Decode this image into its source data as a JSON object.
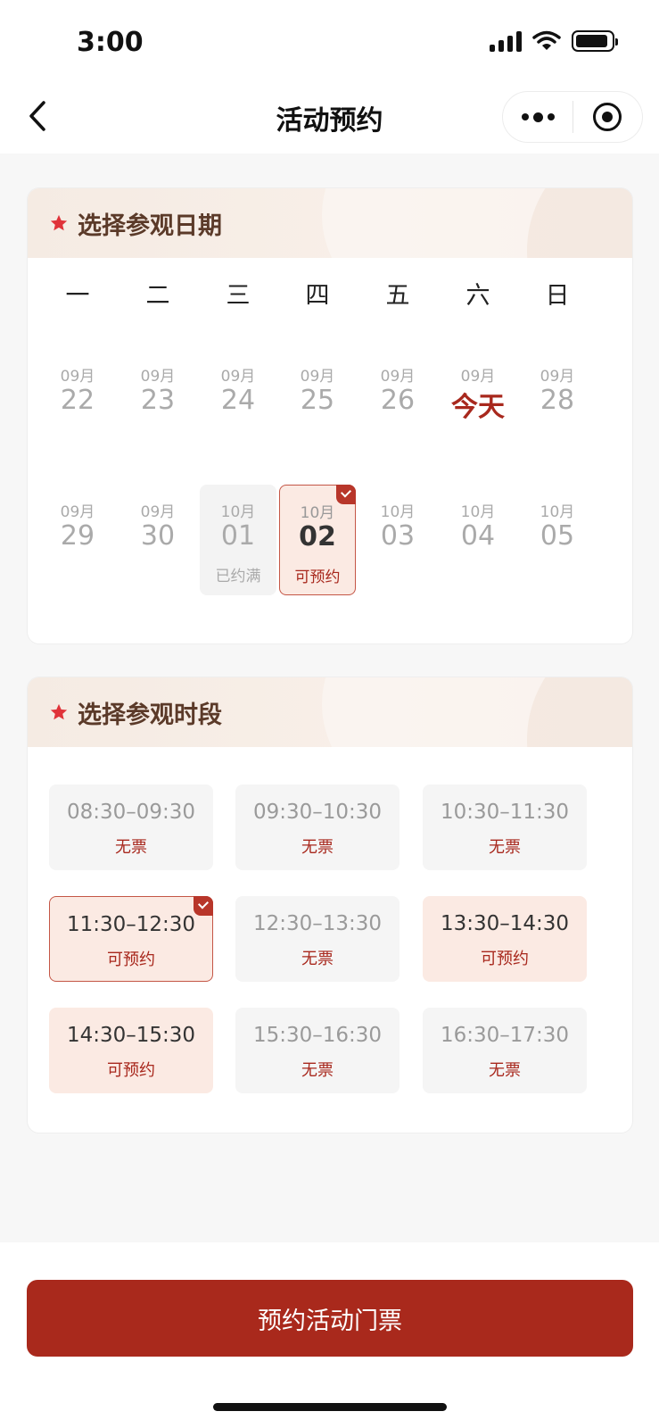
{
  "status": {
    "time": "3:00"
  },
  "nav": {
    "title": "活动预约"
  },
  "date_section": {
    "title": "选择参观日期",
    "weekdays": [
      "一",
      "二",
      "三",
      "四",
      "五",
      "六",
      "日"
    ],
    "days": [
      {
        "month": "09月",
        "day": "22",
        "status": ""
      },
      {
        "month": "09月",
        "day": "23",
        "status": ""
      },
      {
        "month": "09月",
        "day": "24",
        "status": ""
      },
      {
        "month": "09月",
        "day": "25",
        "status": ""
      },
      {
        "month": "09月",
        "day": "26",
        "status": ""
      },
      {
        "month": "09月",
        "day": "今天",
        "status": ""
      },
      {
        "month": "09月",
        "day": "28",
        "status": ""
      },
      {
        "month": "09月",
        "day": "29",
        "status": ""
      },
      {
        "month": "09月",
        "day": "30",
        "status": ""
      },
      {
        "month": "10月",
        "day": "01",
        "status": "已约满"
      },
      {
        "month": "10月",
        "day": "02",
        "status": "可预约"
      },
      {
        "month": "10月",
        "day": "03",
        "status": ""
      },
      {
        "month": "10月",
        "day": "04",
        "status": ""
      },
      {
        "month": "10月",
        "day": "05",
        "status": ""
      }
    ]
  },
  "time_section": {
    "title": "选择参观时段",
    "slots": [
      {
        "time": "08:30–09:30",
        "status": "无票"
      },
      {
        "time": "09:30–10:30",
        "status": "无票"
      },
      {
        "time": "10:30–11:30",
        "status": "无票"
      },
      {
        "time": "11:30–12:30",
        "status": "可预约"
      },
      {
        "time": "12:30–13:30",
        "status": "无票"
      },
      {
        "time": "13:30–14:30",
        "status": "可预约"
      },
      {
        "time": "14:30–15:30",
        "status": "可预约"
      },
      {
        "time": "15:30–16:30",
        "status": "无票"
      },
      {
        "time": "16:30–17:30",
        "status": "无票"
      }
    ]
  },
  "footer": {
    "button_label": "预约活动门票"
  },
  "colors": {
    "accent": "#a9291c",
    "selected_bg": "#fbeae3",
    "header_text": "#5b3a29"
  },
  "icons": [
    "back-icon",
    "more-icon",
    "target-icon",
    "star-icon",
    "check-icon"
  ]
}
